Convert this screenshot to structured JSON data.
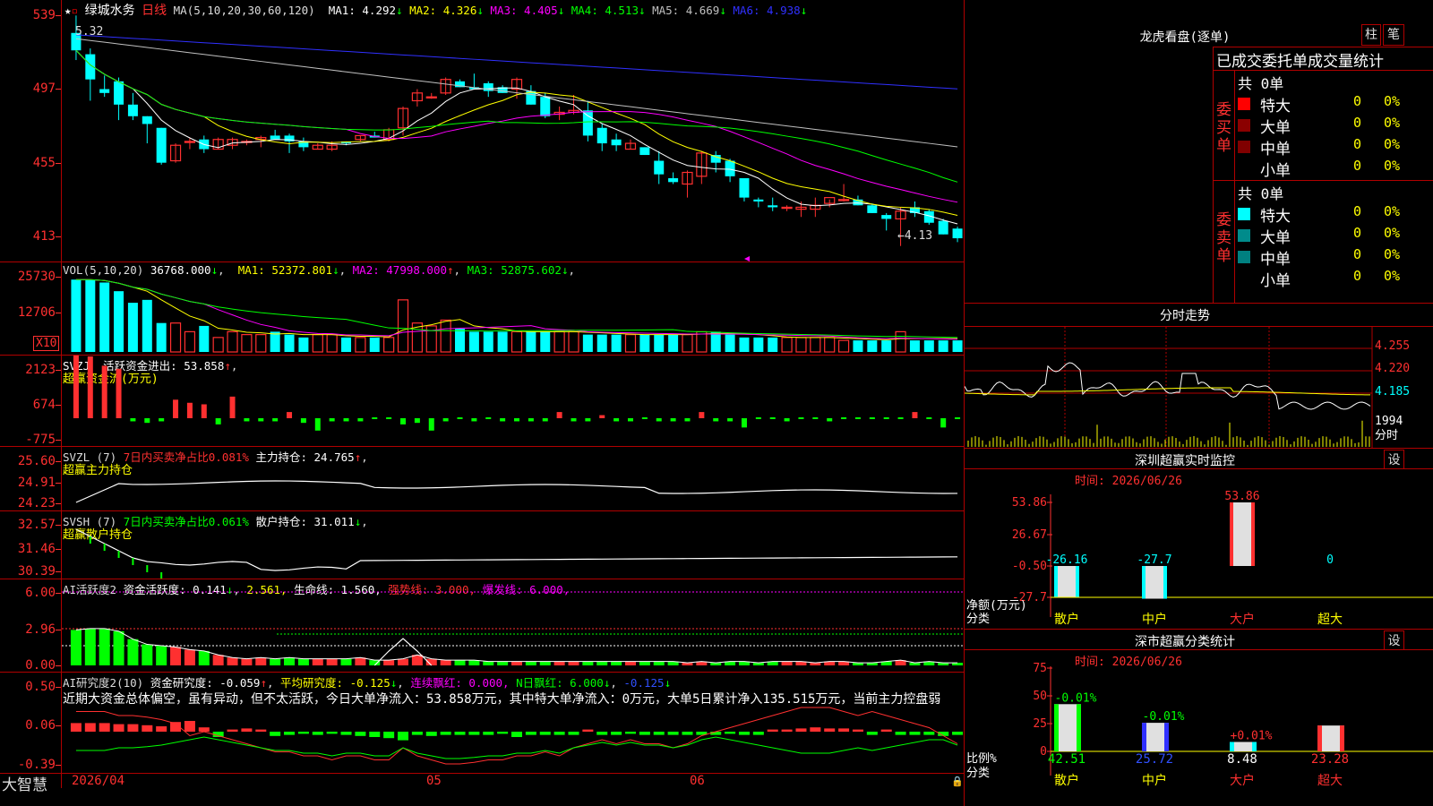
{
  "stock": {
    "name": "绿城水务",
    "period": "日线",
    "star": "★"
  },
  "main_header": {
    "ma_label": "MA(5,10,20,30,60,120)",
    "items": [
      {
        "label": "MA1:",
        "value": "4.292",
        "arrow": "↓",
        "color": "#ffffff"
      },
      {
        "label": "MA2:",
        "value": "4.326",
        "arrow": "↓",
        "color": "#ffff00"
      },
      {
        "label": "MA3:",
        "value": "4.405",
        "arrow": "↓",
        "color": "#ff00ff"
      },
      {
        "label": "MA4:",
        "value": "4.513",
        "arrow": "↓",
        "color": "#00ff00"
      },
      {
        "label": "MA5:",
        "value": "4.669",
        "arrow": "↓",
        "color": "#c0c0c0"
      },
      {
        "label": "MA6:",
        "value": "4.938",
        "arrow": "↓",
        "color": "#3030ff"
      }
    ]
  },
  "main_axis": [
    "539",
    "497",
    "455",
    "413"
  ],
  "price_annotations": {
    "high": "5.32",
    "low": "←4.13"
  },
  "vol_header": {
    "label": "VOL(5,10,20)",
    "value": "36768.000",
    "arrow": "↓",
    "items": [
      {
        "label": "MA1:",
        "value": "52372.801",
        "arrow": "↓",
        "color": "#ffff00"
      },
      {
        "label": "MA2:",
        "value": "47998.000",
        "arrow": "↑",
        "color": "#ff00ff"
      },
      {
        "label": "MA3:",
        "value": "52875.602",
        "arrow": "↓",
        "color": "#00ff00"
      }
    ]
  },
  "vol_axis": [
    "25730",
    "12706"
  ],
  "vol_unit": "X10",
  "svzj": {
    "line1": "SVZJ  活跃资金进出: 53.858",
    "arrow": "↑",
    "suffix": ",",
    "line2": "超赢资金流(万元)",
    "axis": [
      "2123",
      "674",
      "-775"
    ]
  },
  "svzl": {
    "name": "SVZL (7)",
    "ratio": "7日内买卖净占比0.081%",
    "hold": "主力持仓: 24.765",
    "arrow": "↑",
    "suffix": ",",
    "line2": "超赢主力持仓",
    "axis": [
      "25.60",
      "24.91",
      "24.23"
    ]
  },
  "svsh": {
    "name": "SVSH (7)",
    "ratio": "7日内买卖净占比0.061%",
    "hold": "散户持仓: 31.011",
    "arrow": "↓",
    "suffix": ",",
    "line2": "超赢散户持仓",
    "axis": [
      "32.57",
      "31.46",
      "30.39"
    ]
  },
  "ai_active": {
    "name": "AI活跃度2",
    "activity": "资金活跃度: 0.141",
    "arrow": "↓",
    "v2": "2.561,",
    "life": "生命线: 1.560,",
    "strong": "强势线: 3.000,",
    "burst": "爆发线: 6.000,",
    "axis": [
      "6.00",
      "2.96",
      "0.00"
    ]
  },
  "ai_research": {
    "name": "AI研究度2(10)",
    "research": "资金研究度: -0.059",
    "r_arrow": "↑",
    "suffix": ",",
    "avg": "平均研究度: -0.125",
    "avg_arrow": "↓",
    "avg_suffix": ",",
    "red": "连续飘红: 0.000,",
    "nred": "N日飘红: 6.000",
    "n_arrow": "↓",
    "n_suffix": ",",
    "last": "-0.125",
    "last_arrow": "↓",
    "summary": "近期大资金总体偏空，虽有异动，但不太活跃，今日大单净流入：53.858万元，其中特大单净流入：0万元，大单5日累计净入135.515万元，当前主力控盘弱",
    "axis": [
      "0.50",
      "0.06",
      "-0.39"
    ]
  },
  "date_axis": {
    "labels": [
      "2026/04",
      "05",
      "06"
    ],
    "brand": "大智慧"
  },
  "right_panel": {
    "dragon_title": "龙虎看盘(逐单)",
    "btn_zhu": "柱",
    "btn_bi": "笔",
    "stat_title": "已成交委托单成交量统计",
    "buy_label": [
      "委",
      "买",
      "单"
    ],
    "sell_label": [
      "委",
      "卖",
      "单"
    ],
    "buy": {
      "total": "共 0单",
      "rows": [
        {
          "name": "特大",
          "qty": "0",
          "pct": "0%",
          "color": "#ff0000"
        },
        {
          "name": "大单",
          "qty": "0",
          "pct": "0%",
          "color": "#8b0000"
        },
        {
          "name": "中单",
          "qty": "0",
          "pct": "0%",
          "color": "#800000"
        },
        {
          "name": "小单",
          "qty": "0",
          "pct": "0%",
          "color": ""
        }
      ]
    },
    "sell": {
      "total": "共 0单",
      "rows": [
        {
          "name": "特大",
          "qty": "0",
          "pct": "0%",
          "color": "#00ffff"
        },
        {
          "name": "大单",
          "qty": "0",
          "pct": "0%",
          "color": "#008b8b"
        },
        {
          "name": "中单",
          "qty": "0",
          "pct": "0%",
          "color": "#008080"
        },
        {
          "name": "小单",
          "qty": "0",
          "pct": "0%",
          "color": ""
        }
      ]
    },
    "intraday_title": "分时走势",
    "intraday_axis": [
      "4.255",
      "4.220",
      "4.185",
      "1994",
      "分时"
    ],
    "monitor": {
      "title": "深圳超赢实时监控",
      "btn": "设",
      "time": "时间: 2026/06/26",
      "axis": [
        "53.86",
        "26.67",
        "-0.50",
        "-27.7"
      ],
      "unit": "净额(万元)",
      "cat_label": "分类",
      "categories": [
        "散户",
        "中户",
        "大户",
        "超大"
      ],
      "values": [
        "-26.16",
        "-27.7",
        "53.86",
        "0"
      ]
    },
    "classify": {
      "title": "深市超赢分类统计",
      "btn": "设",
      "time": "时间: 2026/06/26",
      "axis": [
        "75",
        "50",
        "25",
        "0"
      ],
      "unit": "比例%",
      "cat_label": "分类",
      "categories": [
        "散户",
        "中户",
        "大户",
        "超大"
      ],
      "top": [
        "-0.01%",
        "-0.01%",
        "+0.01%",
        ""
      ],
      "values": [
        "42.51",
        "25.72",
        "8.48",
        "23.28"
      ]
    }
  },
  "chart_data": {
    "type": "candlestick",
    "dates_label": [
      "2026/04",
      "05",
      "06"
    ],
    "ohlc": [
      [
        5.23,
        5.32,
        5.09,
        5.14
      ],
      [
        5.12,
        5.15,
        4.88,
        4.99
      ],
      [
        4.94,
        5.01,
        4.9,
        4.92
      ],
      [
        4.98,
        5.0,
        4.78,
        4.86
      ],
      [
        4.86,
        4.92,
        4.78,
        4.8
      ],
      [
        4.8,
        4.8,
        4.66,
        4.76
      ],
      [
        4.74,
        4.74,
        4.55,
        4.56
      ],
      [
        4.57,
        4.66,
        4.56,
        4.65
      ],
      [
        4.67,
        4.69,
        4.63,
        4.67
      ],
      [
        4.68,
        4.7,
        4.61,
        4.63
      ],
      [
        4.63,
        4.69,
        4.63,
        4.68
      ],
      [
        4.65,
        4.69,
        4.63,
        4.68
      ],
      [
        4.67,
        4.68,
        4.65,
        4.67
      ],
      [
        4.68,
        4.7,
        4.64,
        4.69
      ],
      [
        4.7,
        4.73,
        4.68,
        4.68
      ],
      [
        4.7,
        4.71,
        4.61,
        4.67
      ],
      [
        4.67,
        4.69,
        4.62,
        4.64
      ],
      [
        4.63,
        4.66,
        4.63,
        4.65
      ],
      [
        4.63,
        4.67,
        4.62,
        4.65
      ],
      [
        4.67,
        4.67,
        4.65,
        4.66
      ],
      [
        4.68,
        4.7,
        4.67,
        4.7
      ],
      [
        4.7,
        4.72,
        4.69,
        4.69
      ],
      [
        4.68,
        4.74,
        4.67,
        4.73
      ],
      [
        4.74,
        4.85,
        4.7,
        4.84
      ],
      [
        4.88,
        4.94,
        4.85,
        4.92
      ],
      [
        4.9,
        4.92,
        4.89,
        4.9
      ],
      [
        4.92,
        5.0,
        4.91,
        4.99
      ],
      [
        4.98,
        4.99,
        4.95,
        4.95
      ],
      [
        4.95,
        5.02,
        4.94,
        4.94
      ],
      [
        4.97,
        4.98,
        4.9,
        4.93
      ],
      [
        4.95,
        4.96,
        4.92,
        4.92
      ],
      [
        4.94,
        5.0,
        4.89,
        4.99
      ],
      [
        4.93,
        4.96,
        4.86,
        4.86
      ],
      [
        4.9,
        4.92,
        4.79,
        4.8
      ],
      [
        4.81,
        4.85,
        4.78,
        4.82
      ],
      [
        4.82,
        4.91,
        4.81,
        4.83
      ],
      [
        4.83,
        4.88,
        4.67,
        4.7
      ],
      [
        4.74,
        4.76,
        4.62,
        4.66
      ],
      [
        4.68,
        4.71,
        4.62,
        4.65
      ],
      [
        4.63,
        4.68,
        4.63,
        4.66
      ],
      [
        4.64,
        4.64,
        4.6,
        4.6
      ],
      [
        4.57,
        4.62,
        4.45,
        4.5
      ],
      [
        4.48,
        4.51,
        4.45,
        4.46
      ],
      [
        4.45,
        4.52,
        4.38,
        4.51
      ],
      [
        4.49,
        4.62,
        4.45,
        4.61
      ],
      [
        4.6,
        4.62,
        4.51,
        4.56
      ],
      [
        4.57,
        4.58,
        4.46,
        4.49
      ],
      [
        4.48,
        4.48,
        4.36,
        4.38
      ],
      [
        4.37,
        4.38,
        4.33,
        4.36
      ],
      [
        4.34,
        4.38,
        4.31,
        4.33
      ],
      [
        4.33,
        4.34,
        4.31,
        4.33
      ],
      [
        4.32,
        4.36,
        4.28,
        4.33
      ],
      [
        4.32,
        4.38,
        4.28,
        4.34
      ],
      [
        4.35,
        4.37,
        4.33,
        4.38
      ],
      [
        4.37,
        4.45,
        4.36,
        4.37
      ],
      [
        4.37,
        4.39,
        4.34,
        4.34
      ],
      [
        4.34,
        4.35,
        4.3,
        4.3
      ],
      [
        4.29,
        4.3,
        4.21,
        4.27
      ],
      [
        4.27,
        4.33,
        4.13,
        4.31
      ],
      [
        4.33,
        4.36,
        4.28,
        4.3
      ],
      [
        4.31,
        4.32,
        4.24,
        4.25
      ],
      [
        4.26,
        4.27,
        4.19,
        4.19
      ],
      [
        4.22,
        4.23,
        4.15,
        4.17
      ]
    ],
    "ylim": [
      4.05,
      5.4
    ]
  }
}
